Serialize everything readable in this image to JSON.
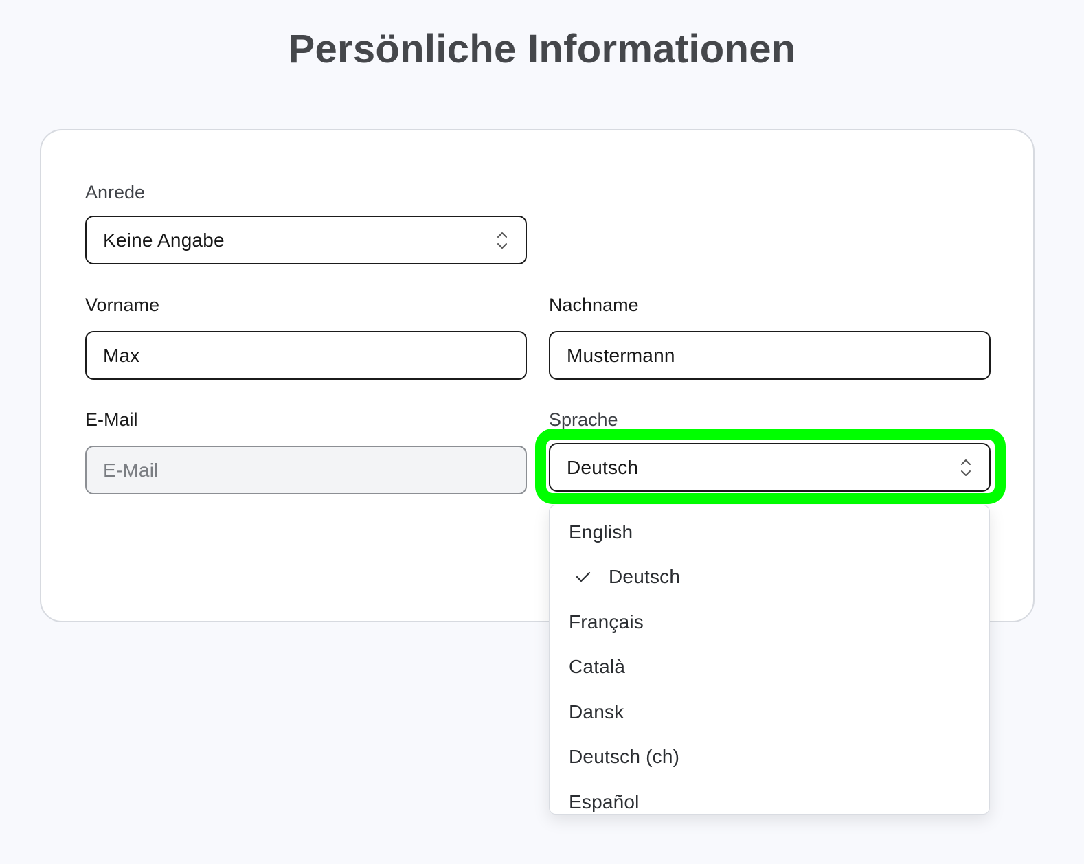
{
  "page": {
    "title": "Persönliche Informationen"
  },
  "form": {
    "salutation": {
      "label": "Anrede",
      "value": "Keine Angabe"
    },
    "first_name": {
      "label": "Vorname",
      "value": "Max"
    },
    "last_name": {
      "label": "Nachname",
      "value": "Mustermann"
    },
    "email": {
      "label": "E-Mail",
      "placeholder": "E-Mail",
      "value": ""
    },
    "language": {
      "label": "Sprache",
      "value": "Deutsch",
      "options": [
        {
          "label": "English",
          "selected": false
        },
        {
          "label": "Deutsch",
          "selected": true
        },
        {
          "label": "Français",
          "selected": false
        },
        {
          "label": "Català",
          "selected": false
        },
        {
          "label": "Dansk",
          "selected": false
        },
        {
          "label": "Deutsch (ch)",
          "selected": false
        },
        {
          "label": "Español",
          "selected": false
        }
      ]
    }
  },
  "colors": {
    "background": "#f8f9fd",
    "card": "#ffffff",
    "focus_highlight": "#00ff00",
    "title": "#45474b"
  },
  "icons": {
    "select_indicator": "chevron-up-down-icon",
    "selected_option": "check-icon"
  }
}
